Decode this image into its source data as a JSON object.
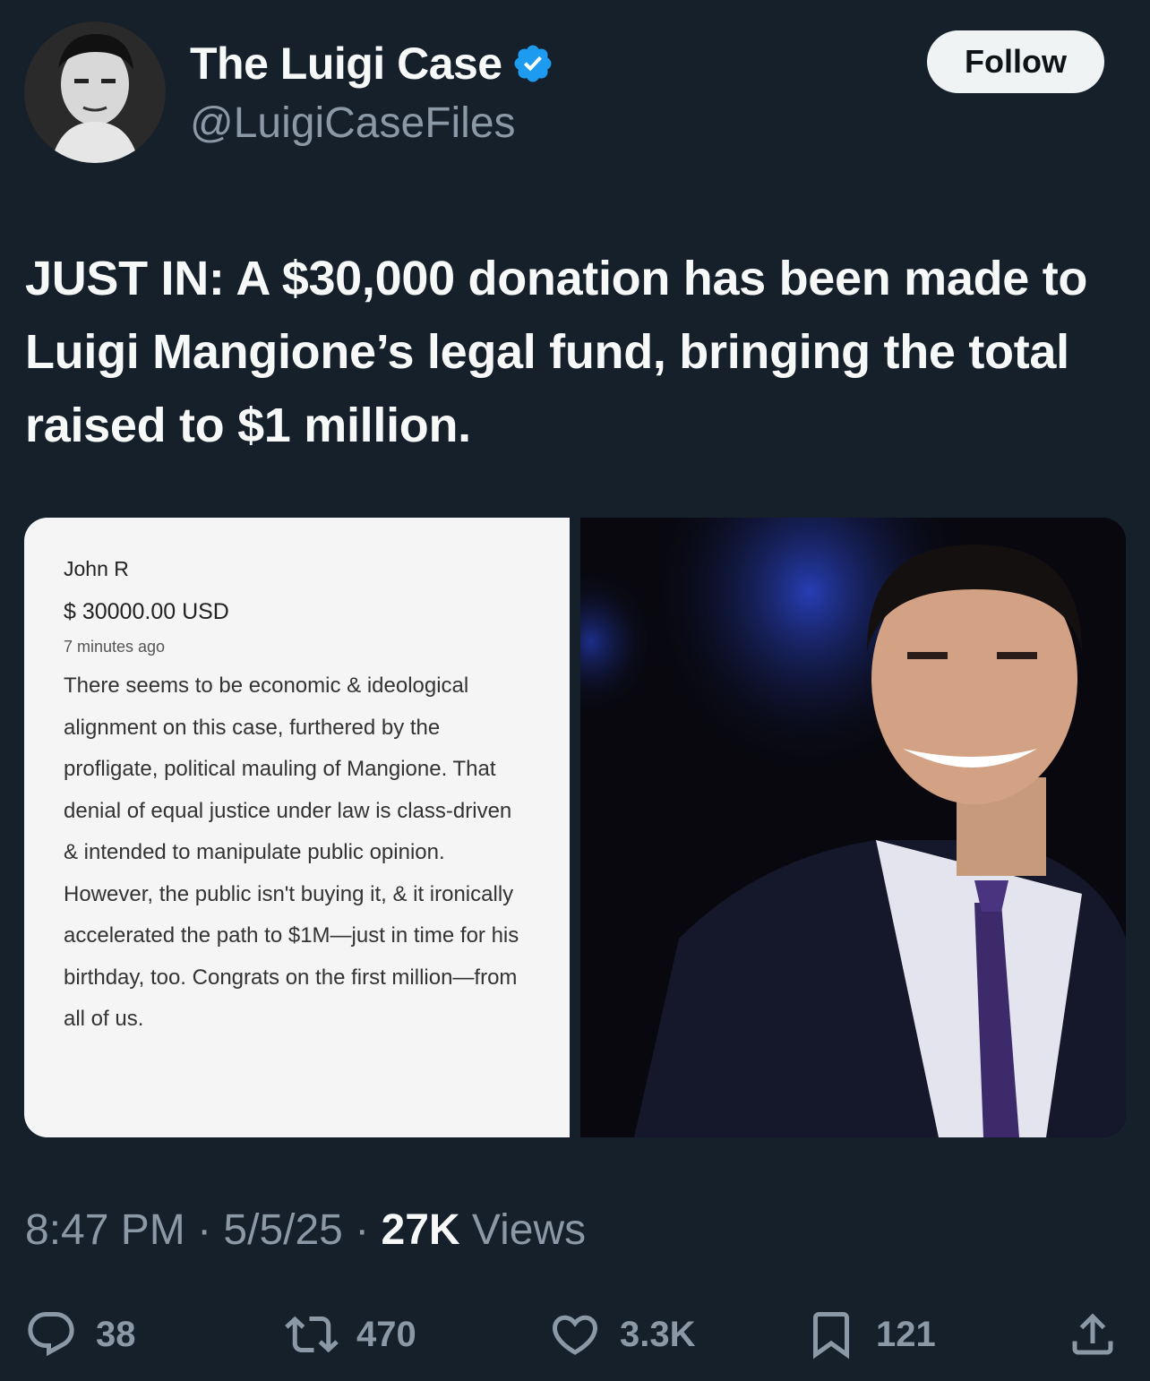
{
  "author": {
    "display_name": "The Luigi Case",
    "handle": "@LuigiCaseFiles",
    "verified": true,
    "avatar_icon": "avatar-portrait",
    "verified_color": "#1d9bf0"
  },
  "follow_label": "Follow",
  "tweet": {
    "text": "JUST IN: A $30,000 donation has been made to Luigi Mangione’s legal fund, bringing the total raised to $1 million."
  },
  "donation_card": {
    "name": "John R",
    "amount": "$ 30000.00 USD",
    "time": "7 minutes ago",
    "message": "There seems to be economic & ideological alignment on this case, furthered by the profligate, political mauling of Mangione. That denial of equal justice under law is class-driven & intended to manipulate public opinion. However, the public isn't buying it, & it ironically accelerated the path to $1M—just in time for his birthday, too. Congrats on the first million—from all of us."
  },
  "meta": {
    "time": "8:47 PM",
    "sep1": " · ",
    "date": "5/5/25",
    "sep2": " · ",
    "views_count": "27K",
    "views_label": " Views"
  },
  "actions": {
    "replies": "38",
    "reposts": "470",
    "likes": "3.3K",
    "bookmarks": "121"
  },
  "colors": {
    "background": "#15202b",
    "muted": "#8b98a5",
    "text": "#f7f9f9"
  }
}
